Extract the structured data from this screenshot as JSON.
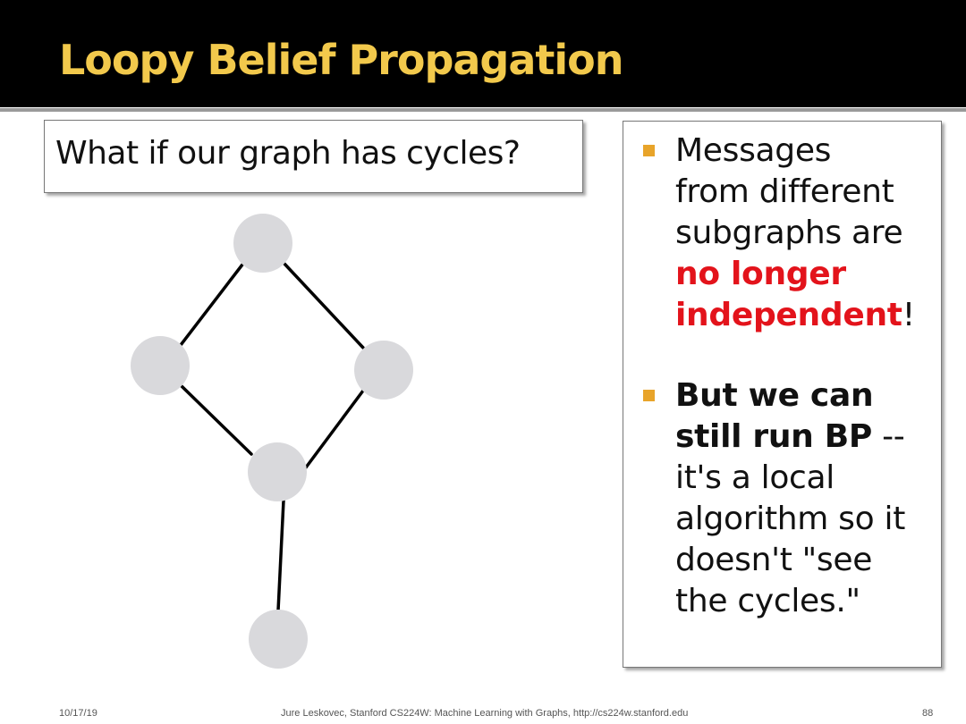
{
  "slide": {
    "title": "Loopy Belief Propagation",
    "question": "What if our graph has cycles?",
    "bullets": [
      {
        "line1": "Messages",
        "line2": "from different",
        "line3": "subgraphs are",
        "emphasis1": "no longer",
        "emphasis2": "independent",
        "tail": "!"
      },
      {
        "bold1": "But we can",
        "bold2": "still run BP",
        "dash": " --",
        "line3": "it's a local",
        "line4": "algorithm so it",
        "line5": "doesn't \"see",
        "line6": "the cycles.\""
      }
    ]
  },
  "footer": {
    "date": "10/17/19",
    "credit": "Jure Leskovec, Stanford CS224W: Machine Learning with Graphs, http://cs224w.stanford.edu",
    "page": "88"
  },
  "colors": {
    "title": "#f2c94c",
    "title_bar": "#000000",
    "emphasis": "#e3131b",
    "bullet_marker": "#e8a42a",
    "node": "#d9d9dc",
    "edge": "#000000"
  }
}
